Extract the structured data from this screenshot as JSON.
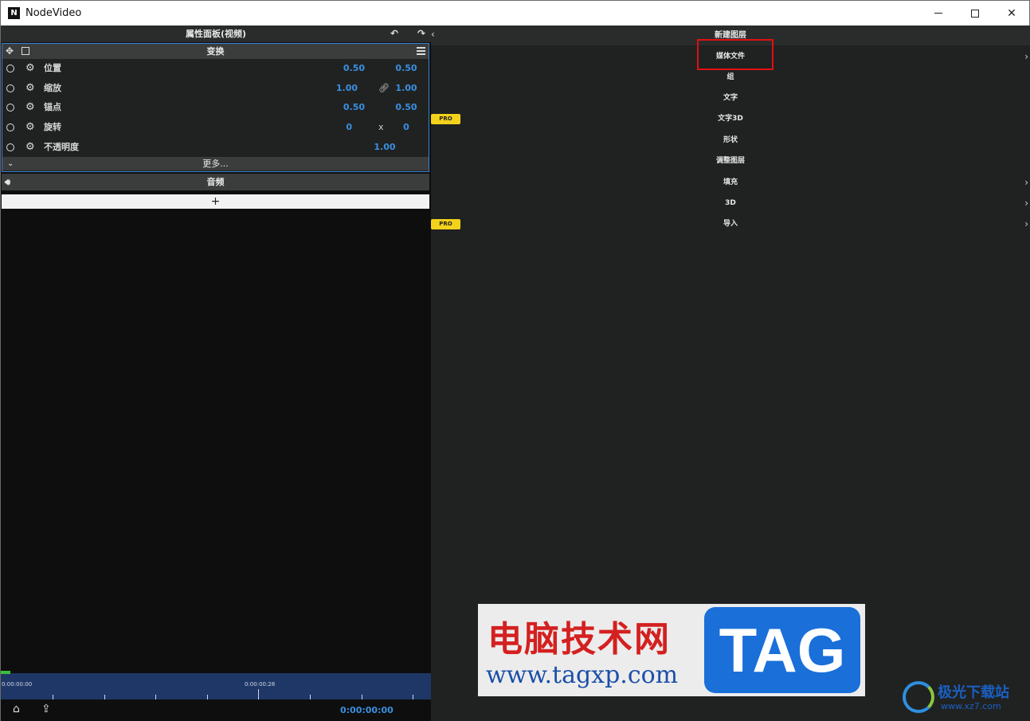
{
  "window": {
    "title": "NodeVideo",
    "logo": "nodevideo-logo-icon"
  },
  "left_panel": {
    "header": "属性面板(视频)",
    "transform": {
      "title": "变换",
      "rows": [
        {
          "label": "位置",
          "v1": "0.50",
          "v2": "0.50"
        },
        {
          "label": "缩放",
          "v1": "1.00",
          "v2": "1.00",
          "link_icon": "link-icon"
        },
        {
          "label": "锚点",
          "v1": "0.50",
          "v2": "0.50"
        },
        {
          "label": "旋转",
          "v1": "0",
          "mid": "x",
          "v2": "0"
        },
        {
          "label": "不透明度",
          "v": "1.00"
        }
      ],
      "more": "更多..."
    },
    "audio": "音频",
    "add": "+",
    "timeline": {
      "t0": "0:00:00:00",
      "t1": "0:00:00:28"
    },
    "timecode": "0:00:00:00"
  },
  "right_panel": {
    "title": "新建图层",
    "items": [
      {
        "label": "媒体文件",
        "arrow": true
      },
      {
        "label": "组"
      },
      {
        "label": "文字"
      },
      {
        "label": "文字3D",
        "pro": "PRO"
      },
      {
        "label": "形状"
      },
      {
        "label": "调整图层"
      },
      {
        "label": "填充",
        "arrow": true
      },
      {
        "label": "3D",
        "arrow": true
      },
      {
        "label": "导入",
        "pro": "PRO",
        "arrow": true
      }
    ]
  },
  "watermark": {
    "cn": "电脑技术网",
    "url": "www.tagxp.com",
    "tag": "TAG",
    "site2_cn": "极光下载站",
    "site2_url": "www.xz7.com"
  },
  "colors": {
    "accent": "#3a8fe0",
    "pro": "#f3d21b",
    "highlight": "#e01010",
    "timeline": "#1f3766"
  }
}
